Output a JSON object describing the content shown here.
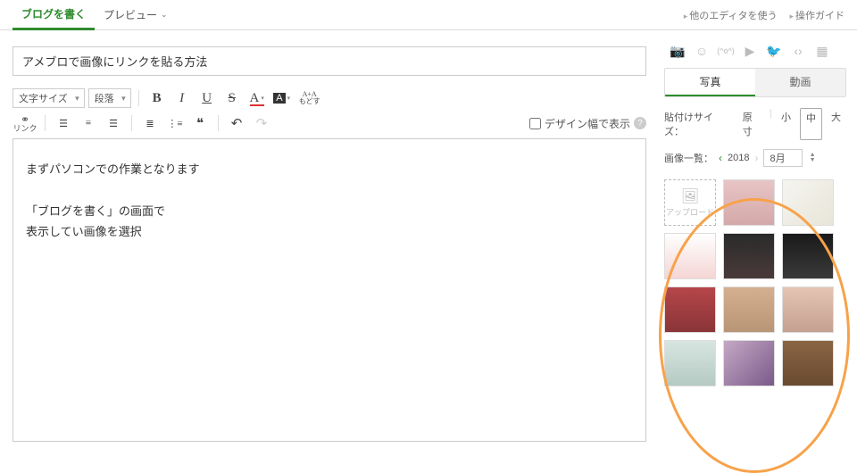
{
  "tabs": {
    "write": "ブログを書く",
    "preview": "プレビュー"
  },
  "topRight": {
    "otherEditor": "他のエディタを使う",
    "guide": "操作ガイド"
  },
  "title": "アメブロで画像にリンクを貼る方法",
  "selects": {
    "fontSize": "文字サイズ",
    "paragraph": "段落"
  },
  "toolbar": {
    "resetLabel": "A+A\nもどす",
    "linkLabel": "リンク"
  },
  "displayWidth": "デザイン幅で表示",
  "editorLines": {
    "l1": "まずパソコンでの作業となります",
    "l2": "「ブログを書く」の画面で",
    "l3": "表示してい画像を選択"
  },
  "sideIcons": [
    "camera",
    "face",
    "kaomoji",
    "youtube",
    "twitter",
    "embed",
    "grid"
  ],
  "mediaTabs": {
    "photo": "写真",
    "video": "動画"
  },
  "sizeLabel": "貼付けサイズ：",
  "sizes": {
    "orig": "原寸",
    "s": "小",
    "m": "中",
    "l": "大",
    "selected": "m"
  },
  "listLabel": "画像一覧：",
  "year": "2018",
  "month": "8月",
  "uploadLabel": "アップロード"
}
